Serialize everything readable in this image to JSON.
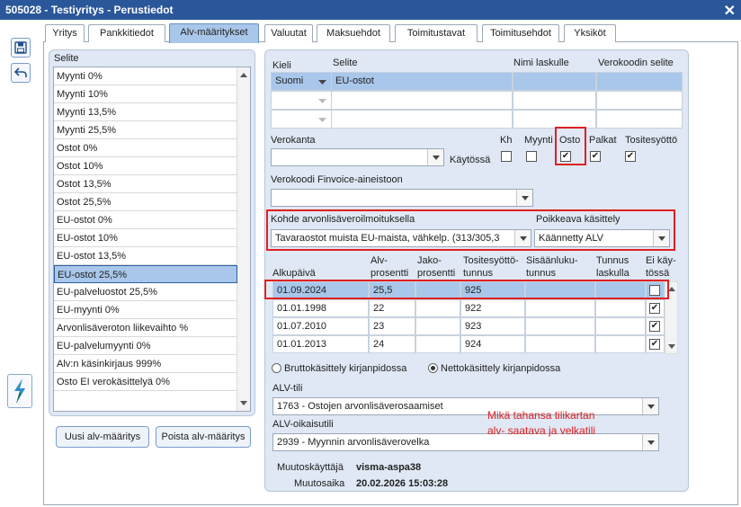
{
  "window": {
    "title": "505028 - Testiyritys - Perustiedot",
    "close": "✕"
  },
  "toolbar": {
    "save_icon": "💾",
    "back_icon": "↶"
  },
  "tabs": [
    {
      "label": "Yritys"
    },
    {
      "label": "Pankkitiedot"
    },
    {
      "label": "Alv-määritykset"
    },
    {
      "label": "Valuutat"
    },
    {
      "label": "Maksuehdot"
    },
    {
      "label": "Toimitustavat"
    },
    {
      "label": "Toimitusehdot"
    },
    {
      "label": "Yksiköt"
    }
  ],
  "list": {
    "header": "Selite",
    "items": [
      "Myynti 0%",
      "Myynti 10%",
      "Myynti 13,5%",
      "Myynti 25,5%",
      "Ostot 0%",
      "Ostot 10%",
      "Ostot 13,5%",
      "Ostot 25,5%",
      "EU-ostot 0%",
      "EU-ostot 10%",
      "EU-ostot 13,5%",
      "EU-ostot 25,5%",
      "EU-palveluostot 25,5%",
      "EU-myynti 0%",
      "Arvonlisäveroton liikevaihto %",
      "EU-palvelumyynti 0%",
      "Alv:n käsinkirjaus 999%",
      "Osto EI verokäsittelyä 0%"
    ],
    "selected_index": 11
  },
  "buttons": {
    "new": "Uusi alv-määritys",
    "delete": "Poista alv-määritys"
  },
  "lang_table": {
    "headers": {
      "kieli": "Kieli",
      "selite": "Selite",
      "nimi": "Nimi laskulle",
      "verokoodi": "Verokoodin selite"
    },
    "row": {
      "kieli": "Suomi",
      "selite": "EU-ostot"
    }
  },
  "verokanta": {
    "label": "Verokanta",
    "kaytossa_label": "Käytössä",
    "kh_label": "Kh",
    "myynti_label": "Myynti",
    "osto_label": "Osto",
    "palkat_label": "Palkat",
    "tositesyotto_label": "Tositesyöttö",
    "check_mark": "✔"
  },
  "finvoice": {
    "label": "Verokoodi Finvoice-aineistoon"
  },
  "kohde": {
    "label": "Kohde arvonlisäveroilmoituksella",
    "value": "Tavaraostot muista EU-maista, vähkelp. (313/305,3",
    "poik_label": "Poikkeava käsittely",
    "poik_value": "Käännetty ALV"
  },
  "rates": {
    "headers": {
      "alkupaiva": "Alkupäivä",
      "alv1": "Alv-",
      "alv2": "prosentti",
      "jako1": "Jako-",
      "jako2": "prosentti",
      "tos1": "Tositesyöttö-",
      "tos2": "tunnus",
      "sis1": "Sisäänluku-",
      "sis2": "tunnus",
      "tun1": "Tunnus",
      "tun2": "laskulla",
      "ei1": "Ei käy-",
      "ei2": "tössä"
    },
    "rows": [
      {
        "date": "01.09.2024",
        "alv": "25,5",
        "tunnus": "925"
      },
      {
        "date": "01.01.1998",
        "alv": "22",
        "tunnus": "922"
      },
      {
        "date": "01.07.2010",
        "alv": "23",
        "tunnus": "923"
      },
      {
        "date": "01.01.2013",
        "alv": "24",
        "tunnus": "924"
      }
    ]
  },
  "radios": {
    "brutto": "Bruttokäsittely kirjanpidossa",
    "netto": "Nettokäsittely kirjanpidossa"
  },
  "alv_tili": {
    "label": "ALV-tili",
    "value": "1763 - Ostojen arvonlisäverosaamiset"
  },
  "alv_oik": {
    "label": "ALV-oikaisutili",
    "value": "2939 - Myynnin arvonlisäverovelka"
  },
  "annotation": {
    "line1": "Mikä tahansa tilikartan",
    "line2": "alv- saatava ja velkatili"
  },
  "audit": {
    "user_label": "Muutoskäyttäjä",
    "user_value": "visma-aspa38",
    "time_label": "Muutosaika",
    "time_value": "20.02.2026 15:03:28"
  }
}
